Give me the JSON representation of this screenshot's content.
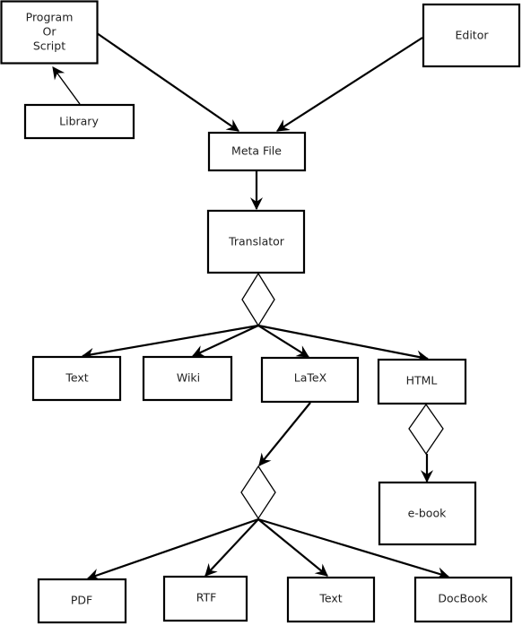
{
  "diagram": {
    "nodes": [
      {
        "id": "program",
        "lines": [
          "Program",
          "Or",
          "Script"
        ]
      },
      {
        "id": "library",
        "lines": [
          "Library"
        ]
      },
      {
        "id": "editor",
        "lines": [
          "Editor"
        ]
      },
      {
        "id": "metafile",
        "lines": [
          "Meta File"
        ]
      },
      {
        "id": "translator",
        "lines": [
          "Translator"
        ]
      },
      {
        "id": "text1",
        "lines": [
          "Text"
        ]
      },
      {
        "id": "wiki",
        "lines": [
          "Wiki"
        ]
      },
      {
        "id": "latex",
        "lines": [
          "LaTeX"
        ]
      },
      {
        "id": "html",
        "lines": [
          "HTML"
        ]
      },
      {
        "id": "ebook",
        "lines": [
          "e-book"
        ]
      },
      {
        "id": "pdf",
        "lines": [
          "PDF"
        ]
      },
      {
        "id": "rtf",
        "lines": [
          "RTF"
        ]
      },
      {
        "id": "text2",
        "lines": [
          "Text"
        ]
      },
      {
        "id": "docbook",
        "lines": [
          "DocBook"
        ]
      }
    ],
    "decisions": [
      "translator-split",
      "html-split",
      "latex-split"
    ],
    "edges": [
      {
        "from": "library",
        "to": "program"
      },
      {
        "from": "program",
        "to": "metafile"
      },
      {
        "from": "editor",
        "to": "metafile"
      },
      {
        "from": "metafile",
        "to": "translator"
      },
      {
        "from": "translator-split",
        "to": "text1"
      },
      {
        "from": "translator-split",
        "to": "wiki"
      },
      {
        "from": "translator-split",
        "to": "latex"
      },
      {
        "from": "translator-split",
        "to": "html"
      },
      {
        "from": "latex",
        "to": "latex-split"
      },
      {
        "from": "html-split",
        "to": "ebook"
      },
      {
        "from": "latex-split",
        "to": "pdf"
      },
      {
        "from": "latex-split",
        "to": "rtf"
      },
      {
        "from": "latex-split",
        "to": "text2"
      },
      {
        "from": "latex-split",
        "to": "docbook"
      }
    ]
  }
}
